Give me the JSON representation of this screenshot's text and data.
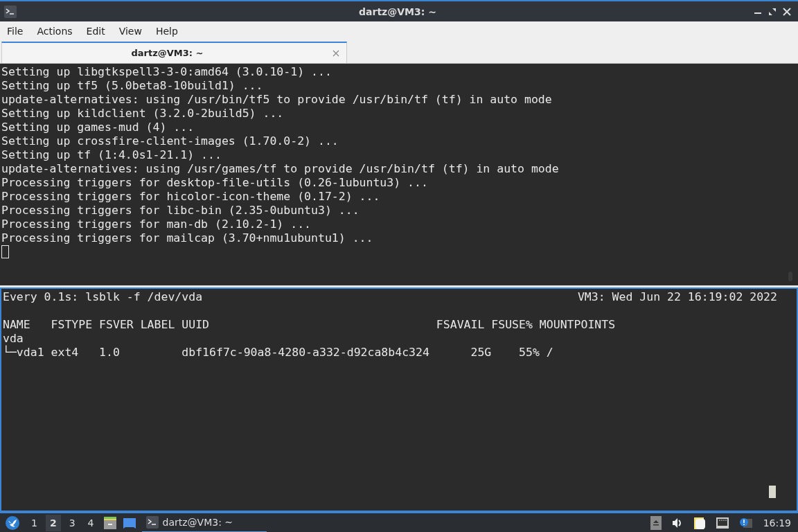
{
  "window": {
    "title": "dartz@VM3: ~"
  },
  "menu": [
    "File",
    "Actions",
    "Edit",
    "View",
    "Help"
  ],
  "tabs": [
    {
      "label": "dartz@VM3: ~",
      "selected": true
    }
  ],
  "top_pane": {
    "lines": [
      "Setting up libgtkspell3-3-0:amd64 (3.0.10-1) ...",
      "Setting up tf5 (5.0beta8-10build1) ...",
      "update-alternatives: using /usr/bin/tf5 to provide /usr/bin/tf (tf) in auto mode",
      "Setting up kildclient (3.2.0-2build5) ...",
      "Setting up games-mud (4) ...",
      "Setting up crossfire-client-images (1.70.0-2) ...",
      "Setting up tf (1:4.0s1-21.1) ...",
      "update-alternatives: using /usr/games/tf to provide /usr/bin/tf (tf) in auto mode",
      "Processing triggers for desktop-file-utils (0.26-1ubuntu3) ...",
      "Processing triggers for hicolor-icon-theme (0.17-2) ...",
      "Processing triggers for libc-bin (2.35-0ubuntu3) ...",
      "Processing triggers for man-db (2.10.2-1) ...",
      "Processing triggers for mailcap (3.70+nmu1ubuntu1) ..."
    ]
  },
  "bottom_pane": {
    "header_left": "Every 0.1s: lsblk -f /dev/vda",
    "header_right": "VM3: Wed Jun 22 16:19:02 2022",
    "lines": [
      "NAME   FSTYPE FSVER LABEL UUID                                 FSAVAIL FSUSE% MOUNTPOINTS",
      "vda",
      "└─vda1 ext4   1.0         dbf16f7c-90a8-4280-a332-d92ca8b4c324      25G    55% /"
    ]
  },
  "taskbar": {
    "workspaces": [
      {
        "label": "1",
        "selected": false
      },
      {
        "label": "2",
        "selected": true
      },
      {
        "label": "3",
        "selected": false
      },
      {
        "label": "4",
        "selected": false
      }
    ],
    "tasks": [
      {
        "label": "dartz@VM3: ~",
        "selected": true
      }
    ],
    "clock": "16:19"
  }
}
